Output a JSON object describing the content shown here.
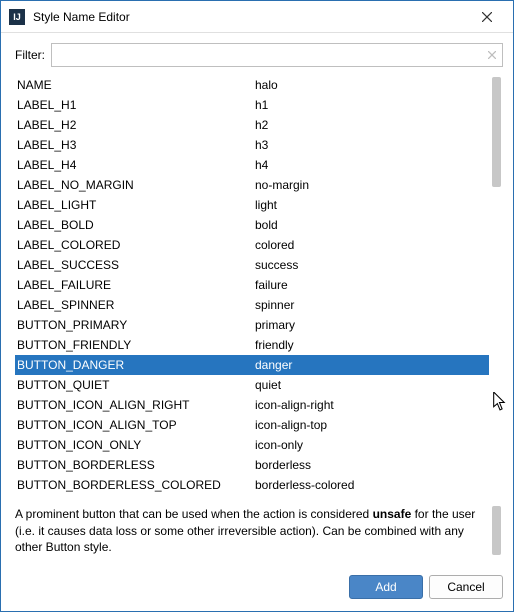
{
  "window": {
    "title": "Style Name Editor"
  },
  "filter": {
    "label": "Filter:",
    "value": "",
    "placeholder": ""
  },
  "table": {
    "selected_index": 14,
    "rows": [
      {
        "name": "NAME",
        "value": "halo"
      },
      {
        "name": "LABEL_H1",
        "value": "h1"
      },
      {
        "name": "LABEL_H2",
        "value": "h2"
      },
      {
        "name": "LABEL_H3",
        "value": "h3"
      },
      {
        "name": "LABEL_H4",
        "value": "h4"
      },
      {
        "name": "LABEL_NO_MARGIN",
        "value": "no-margin"
      },
      {
        "name": "LABEL_LIGHT",
        "value": "light"
      },
      {
        "name": "LABEL_BOLD",
        "value": "bold"
      },
      {
        "name": "LABEL_COLORED",
        "value": "colored"
      },
      {
        "name": "LABEL_SUCCESS",
        "value": "success"
      },
      {
        "name": "LABEL_FAILURE",
        "value": "failure"
      },
      {
        "name": "LABEL_SPINNER",
        "value": "spinner"
      },
      {
        "name": "BUTTON_PRIMARY",
        "value": "primary"
      },
      {
        "name": "BUTTON_FRIENDLY",
        "value": "friendly"
      },
      {
        "name": "BUTTON_DANGER",
        "value": "danger"
      },
      {
        "name": "BUTTON_QUIET",
        "value": "quiet"
      },
      {
        "name": "BUTTON_ICON_ALIGN_RIGHT",
        "value": "icon-align-right"
      },
      {
        "name": "BUTTON_ICON_ALIGN_TOP",
        "value": "icon-align-top"
      },
      {
        "name": "BUTTON_ICON_ONLY",
        "value": "icon-only"
      },
      {
        "name": "BUTTON_BORDERLESS",
        "value": "borderless"
      },
      {
        "name": "BUTTON_BORDERLESS_COLORED",
        "value": "borderless-colored"
      }
    ]
  },
  "description": {
    "pre": "A prominent button that can be used when the action is considered ",
    "bold": "unsafe",
    "post": " for the user (i.e. it causes data loss or some other irreversible action). Can be combined with any other Button style."
  },
  "buttons": {
    "add": "Add",
    "cancel": "Cancel"
  }
}
